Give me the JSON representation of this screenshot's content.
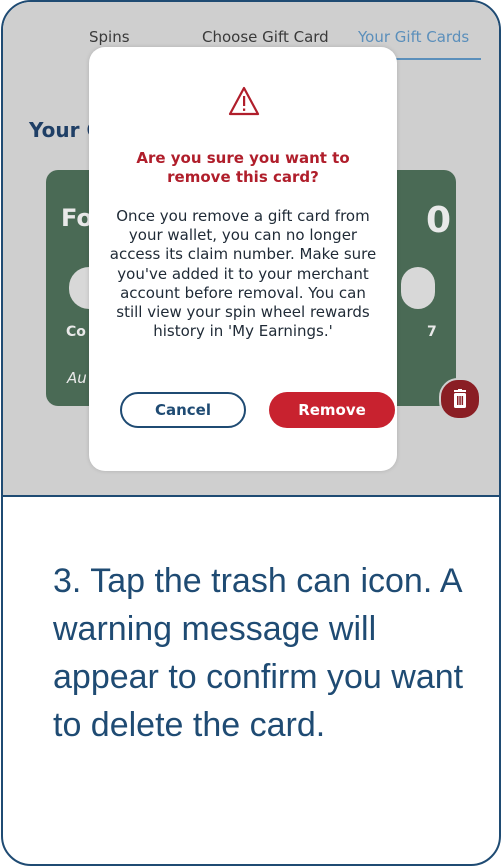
{
  "tabs": [
    {
      "label": "Spins",
      "active": false
    },
    {
      "label": "Choose Gift Card",
      "active": false
    },
    {
      "label": "Your Gift Cards",
      "active": true
    }
  ],
  "section_title": "Your G",
  "card": {
    "title_fragment": "Fo",
    "value_fragment": "0",
    "left_fragment": "Co",
    "right_fragment": "7",
    "italic_fragment": "Au",
    "color": "#4a6a55"
  },
  "modal": {
    "icon": "warning-triangle-icon",
    "title": "Are you sure you want to remove this card?",
    "body": "Once you remove a gift card from your wallet, you can no longer access its claim number. Make sure you've added it to your merchant account before removal. You can still view your spin wheel rewards history in 'My Earnings.'",
    "cancel_label": "Cancel",
    "remove_label": "Remove"
  },
  "instruction": "3. Tap the trash can icon. A warning message will appear to confirm you want to delete the card.",
  "colors": {
    "brand_blue": "#1f4b73",
    "danger_red": "#c8222f",
    "active_tab": "#5b8fbb"
  }
}
